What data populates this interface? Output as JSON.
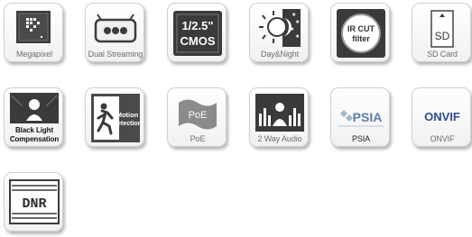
{
  "icons": [
    {
      "name": "megapixel-icon",
      "caption": "Megapixel"
    },
    {
      "name": "dual-streaming-icon",
      "caption": "Dual Streaming"
    },
    {
      "name": "cmos-sensor-icon",
      "caption": "",
      "line1": "1/2.5\"",
      "line2": "CMOS"
    },
    {
      "name": "day-night-icon",
      "caption": "Day&Night"
    },
    {
      "name": "ir-cut-filter-icon",
      "caption": "",
      "line1": "IR CUT",
      "line2": "filter"
    },
    {
      "name": "sd-card-icon",
      "caption": "SD Card",
      "inner": "SD"
    },
    {
      "name": "backlight-compensation-icon",
      "caption_line1": "Black Light",
      "caption_line2": "Compensation"
    },
    {
      "name": "motion-detection-icon",
      "caption": "",
      "line1": "Motion",
      "line2": "Detection"
    },
    {
      "name": "poe-icon",
      "caption": "PoE",
      "inner": "PoE"
    },
    {
      "name": "two-way-audio-icon",
      "caption": "2 Way Audio"
    },
    {
      "name": "psia-icon",
      "caption": "PSIA",
      "inner": "PSIA"
    },
    {
      "name": "onvif-icon",
      "caption": "ONVIF",
      "inner": "ONVIF"
    },
    {
      "name": "dnr-icon",
      "caption": "",
      "inner": "DNR"
    }
  ],
  "colors": {
    "dark_badge": "#3a3a3a",
    "poe_wave": "#8b8b8b",
    "psia_blue": "#5b7fa6",
    "onvif_blue": "#2c4f8f"
  }
}
